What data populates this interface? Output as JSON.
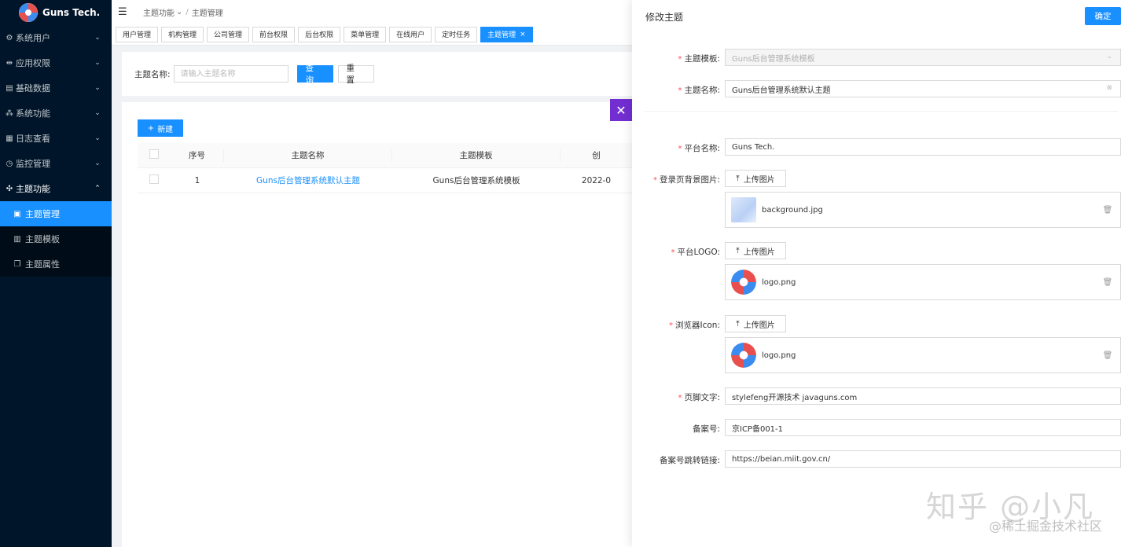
{
  "app": {
    "brand": "Guns Tech."
  },
  "sidebar": {
    "items": [
      {
        "label": "系统用户",
        "icon": "gear-icon",
        "glyph": "⚙",
        "arrow": "⌄"
      },
      {
        "label": "应用权限",
        "icon": "link-icon",
        "glyph": "⇹",
        "arrow": "⌄"
      },
      {
        "label": "基础数据",
        "icon": "database-icon",
        "glyph": "▤",
        "arrow": "⌄"
      },
      {
        "label": "系统功能",
        "icon": "cluster-icon",
        "glyph": "⁂",
        "arrow": "⌄"
      },
      {
        "label": "日志查看",
        "icon": "calendar-icon",
        "glyph": "▦",
        "arrow": "⌄"
      },
      {
        "label": "监控管理",
        "icon": "dashboard-icon",
        "glyph": "◷",
        "arrow": "⌄"
      },
      {
        "label": "主题功能",
        "icon": "theme-icon",
        "glyph": "✣",
        "arrow": "⌃"
      }
    ],
    "subitems": [
      {
        "label": "主题管理",
        "icon": "picture-icon",
        "glyph": "▣"
      },
      {
        "label": "主题模板",
        "icon": "layout-icon",
        "glyph": "▥"
      },
      {
        "label": "主题属性",
        "icon": "copy-icon",
        "glyph": "❐"
      }
    ]
  },
  "header": {
    "menu_glyph": "☰",
    "breadcrumb": [
      "主题功能",
      "主题管理"
    ],
    "crumb_arrow": "⌄",
    "crumb_sep": "/"
  },
  "tabs": [
    "用户管理",
    "机构管理",
    "公司管理",
    "前台权限",
    "后台权限",
    "菜单管理",
    "在线用户",
    "定时任务",
    "主题管理"
  ],
  "tab_close": "×",
  "search": {
    "label": "主题名称:",
    "placeholder": "请输入主题名称",
    "query_label": "查 询",
    "reset_label": "重 置"
  },
  "table": {
    "new_label": "新建",
    "new_glyph": "+",
    "columns": [
      "序号",
      "主题名称",
      "主题模板",
      "创"
    ],
    "rows": [
      {
        "index": "1",
        "name": "Guns后台管理系统默认主题",
        "template": "Guns后台管理系统模板",
        "created": "2022-0"
      }
    ]
  },
  "drawer": {
    "title": "修改主题",
    "confirm_label": "确定",
    "close_glyph": "✕",
    "upload_label": "上传图片",
    "upload_glyph": "⤒",
    "delete_glyph": "🗑",
    "fields": {
      "template": {
        "label": "主题模板:",
        "value": "Guns后台管理系统模板"
      },
      "name": {
        "label": "主题名称:",
        "value": "Guns后台管理系统默认主题"
      },
      "platform": {
        "label": "平台名称:",
        "value": "Guns Tech."
      },
      "login_bg": {
        "label": "登录页背景图片:",
        "file": "background.jpg"
      },
      "logo": {
        "label": "平台LOGO:",
        "file": "logo.png"
      },
      "favicon": {
        "label": "浏览器Icon:",
        "file": "logo.png"
      },
      "footer": {
        "label": "页脚文字:",
        "value": "stylefeng开源技术 javaguns.com"
      },
      "beian": {
        "label": "备案号:",
        "value": "京ICP备001-1"
      },
      "beian_link": {
        "label": "备案号跳转链接:",
        "value": "https://beian.miit.gov.cn/"
      }
    },
    "required_mark": "*",
    "select_arrow": "⌄",
    "clear_glyph": "⊗"
  },
  "watermark": {
    "line1": "知乎 @小凡",
    "line2": "@稀土掘金技术社区"
  },
  "colors": {
    "primary": "#1890ff",
    "sidebar": "#001529",
    "close": "#722ed1",
    "required": "#ff4d4f"
  }
}
